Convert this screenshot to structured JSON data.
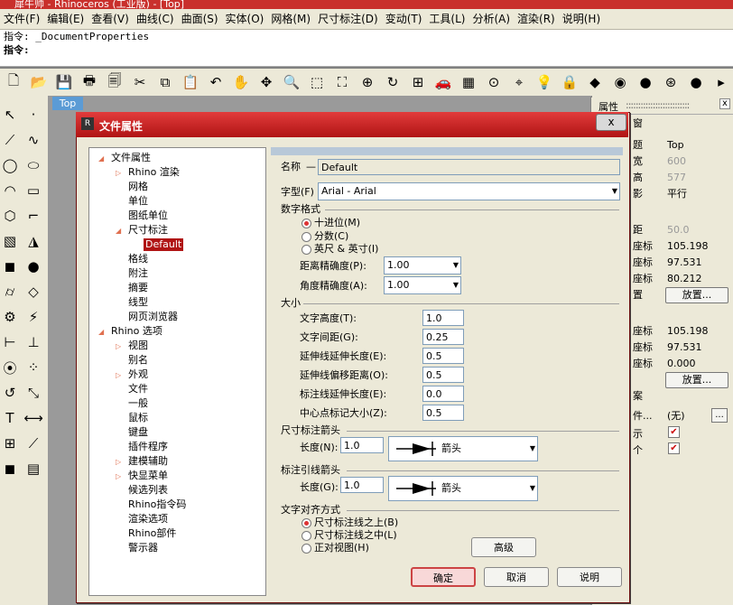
{
  "window": {
    "title": "犀牛帅 - Rhinoceros (工业版) - [Top]"
  },
  "menu": [
    "文件(F)",
    "编辑(E)",
    "查看(V)",
    "曲线(C)",
    "曲面(S)",
    "实体(O)",
    "网格(M)",
    "尺寸标注(D)",
    "变动(T)",
    "工具(L)",
    "分析(A)",
    "渲染(R)",
    "说明(H)"
  ],
  "command": {
    "history": "指令: _DocumentProperties",
    "prompt": "指令:"
  },
  "viewport": {
    "label": "Top"
  },
  "properties_panel": {
    "header": "属性",
    "rows": [
      {
        "k": "窗",
        "v": ""
      },
      {
        "k": "题",
        "v": "Top"
      },
      {
        "k": "宽",
        "v": "600"
      },
      {
        "k": "高",
        "v": "577"
      },
      {
        "k": "影",
        "v": "平行"
      },
      {
        "k": "距",
        "v": "50.0"
      },
      {
        "k": "座标",
        "v": "105.198"
      },
      {
        "k": "座标",
        "v": "97.531"
      },
      {
        "k": "座标",
        "v": "80.212"
      },
      {
        "k": "置",
        "v": ""
      },
      {
        "k": "座标",
        "v": "105.198"
      },
      {
        "k": "座标",
        "v": "97.531"
      },
      {
        "k": "座标",
        "v": "0.000"
      },
      {
        "k": "案",
        "v": ""
      },
      {
        "k": "件...",
        "v": "(无)"
      },
      {
        "k": "示",
        "v": ""
      },
      {
        "k": "个",
        "v": ""
      }
    ],
    "place_button": "放置...",
    "browse_button": "..."
  },
  "dialog": {
    "title": "文件属性",
    "close": "x",
    "tree": [
      {
        "label": "文件属性",
        "level": 0,
        "expanded": true
      },
      {
        "label": "Rhino 渲染",
        "level": 1,
        "collapsed": true
      },
      {
        "label": "网格",
        "level": 1
      },
      {
        "label": "单位",
        "level": 1
      },
      {
        "label": "图纸单位",
        "level": 1
      },
      {
        "label": "尺寸标注",
        "level": 1,
        "expanded": true
      },
      {
        "label": "Default",
        "level": 2,
        "selected": true
      },
      {
        "label": "格线",
        "level": 1
      },
      {
        "label": "附注",
        "level": 1
      },
      {
        "label": "摘要",
        "level": 1
      },
      {
        "label": "线型",
        "level": 1
      },
      {
        "label": "网页浏览器",
        "level": 1
      },
      {
        "label": "Rhino 选项",
        "level": 0,
        "expanded": true
      },
      {
        "label": "视图",
        "level": 1,
        "collapsed": true
      },
      {
        "label": "别名",
        "level": 1
      },
      {
        "label": "外观",
        "level": 1,
        "collapsed": true
      },
      {
        "label": "文件",
        "level": 1
      },
      {
        "label": "一般",
        "level": 1
      },
      {
        "label": "鼠标",
        "level": 1
      },
      {
        "label": "键盘",
        "level": 1
      },
      {
        "label": "插件程序",
        "level": 1
      },
      {
        "label": "建模辅助",
        "level": 1,
        "collapsed": true
      },
      {
        "label": "快显菜单",
        "level": 1,
        "collapsed": true
      },
      {
        "label": "候选列表",
        "level": 1
      },
      {
        "label": "Rhino指令码",
        "level": 1
      },
      {
        "label": "渲染选项",
        "level": 1
      },
      {
        "label": "Rhino部件",
        "level": 1
      },
      {
        "label": "警示器",
        "level": 1
      }
    ],
    "name_label": "名称",
    "name_value": "Default",
    "font_label": "字型(F)",
    "font_value": "Arial - Arial",
    "number_format": {
      "heading": "数字格式",
      "options": [
        "十进位(M)",
        "分数(C)",
        "英尺 & 英寸(I)"
      ],
      "selected": 0,
      "distance_label": "距离精确度(P):",
      "distance_value": "1.00",
      "angle_label": "角度精确度(A):",
      "angle_value": "1.00"
    },
    "size": {
      "heading": "大小",
      "rows": [
        {
          "label": "文字高度(T):",
          "value": "1.0"
        },
        {
          "label": "文字间距(G):",
          "value": "0.25"
        },
        {
          "label": "延伸线延伸长度(E):",
          "value": "0.5"
        },
        {
          "label": "延伸线偏移距离(O):",
          "value": "0.5"
        },
        {
          "label": "标注线延伸长度(E):",
          "value": "0.0"
        },
        {
          "label": "中心点标记大小(Z):",
          "value": "0.5"
        }
      ]
    },
    "dim_arrow": {
      "heading": "尺寸标注箭头",
      "length_label": "长度(N):",
      "length_value": "1.0",
      "style": "箭头"
    },
    "leader_arrow": {
      "heading": "标注引线箭头",
      "length_label": "长度(G):",
      "length_value": "1.0",
      "style": "箭头"
    },
    "text_alignment": {
      "heading": "文字对齐方式",
      "options": [
        "尺寸标注线之上(B)",
        "尺寸标注线之中(L)",
        "正对视图(H)"
      ],
      "selected": 0
    },
    "advanced_button": "高级",
    "ok_button": "确定",
    "cancel_button": "取消",
    "help_button": "说明"
  },
  "colors": {
    "title_red": "#c9302c",
    "selection_red": "#b01414"
  }
}
